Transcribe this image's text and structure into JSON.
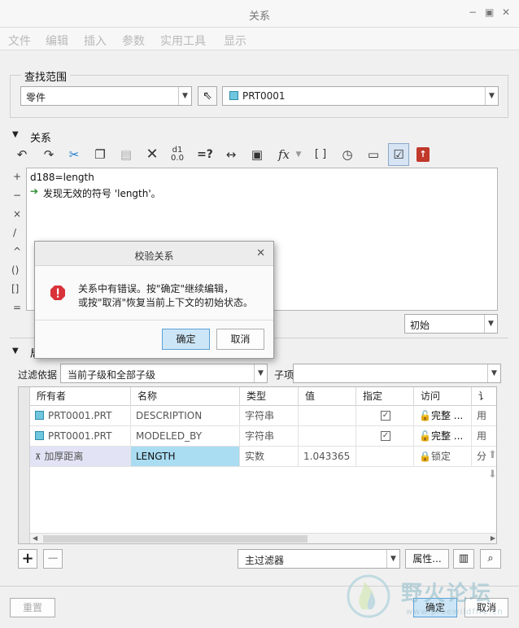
{
  "window": {
    "title": "关系",
    "controls": [
      "−",
      "▣",
      "✕"
    ]
  },
  "menu": [
    "文件",
    "编辑",
    "插入",
    "参数",
    "实用工具",
    "显示"
  ],
  "scope": {
    "title": "查找范围",
    "type_value": "零件",
    "model_value": "PRT0001"
  },
  "relations": {
    "title": "关系",
    "operators": [
      "+",
      "−",
      "×",
      "/",
      "^",
      "()",
      "[]",
      "="
    ],
    "lines": [
      "d188=length",
      "发现无效的符号 'length'。"
    ],
    "initial_value": "初始",
    "toolbar_eq": "=?",
    "toolbar_fx": "fx"
  },
  "dialog": {
    "title": "校验关系",
    "message_line1": "关系中有错误。按\"确定\"继续编辑，",
    "message_line2": "或按\"取消\"恢复当前上下文的初始状态。",
    "ok": "确定",
    "cancel": "取消"
  },
  "params": {
    "title_fragment": "局",
    "filter_label": "过滤依据",
    "filter_value": "当前子级和全部子级",
    "subitem_label": "子项",
    "columns": [
      "所有者",
      "名称",
      "类型",
      "值",
      "指定",
      "访问",
      "讠"
    ],
    "rows": [
      {
        "owner": "PRT0001.PRT",
        "name": "DESCRIPTION",
        "type": "字符串",
        "value": "",
        "designated": true,
        "access": "完整",
        "more": "...",
        "last": "用"
      },
      {
        "owner": "PRT0001.PRT",
        "name": "MODELED_BY",
        "type": "字符串",
        "value": "",
        "designated": true,
        "access": "完整",
        "more": "...",
        "last": "用"
      },
      {
        "owner": "加厚距离",
        "name": "LENGTH",
        "type": "实数",
        "value": "1.043365",
        "designated": false,
        "access": "锁定",
        "more": "",
        "last": "分"
      }
    ],
    "main_filter": "主过滤器",
    "properties_button": "属性...",
    "add": "+",
    "remove": "−"
  },
  "footer": {
    "reset": "重置",
    "ok": "确定",
    "cancel": "取消"
  },
  "watermark": {
    "text": "野火论坛",
    "url": "www.proewildfire.cn"
  }
}
